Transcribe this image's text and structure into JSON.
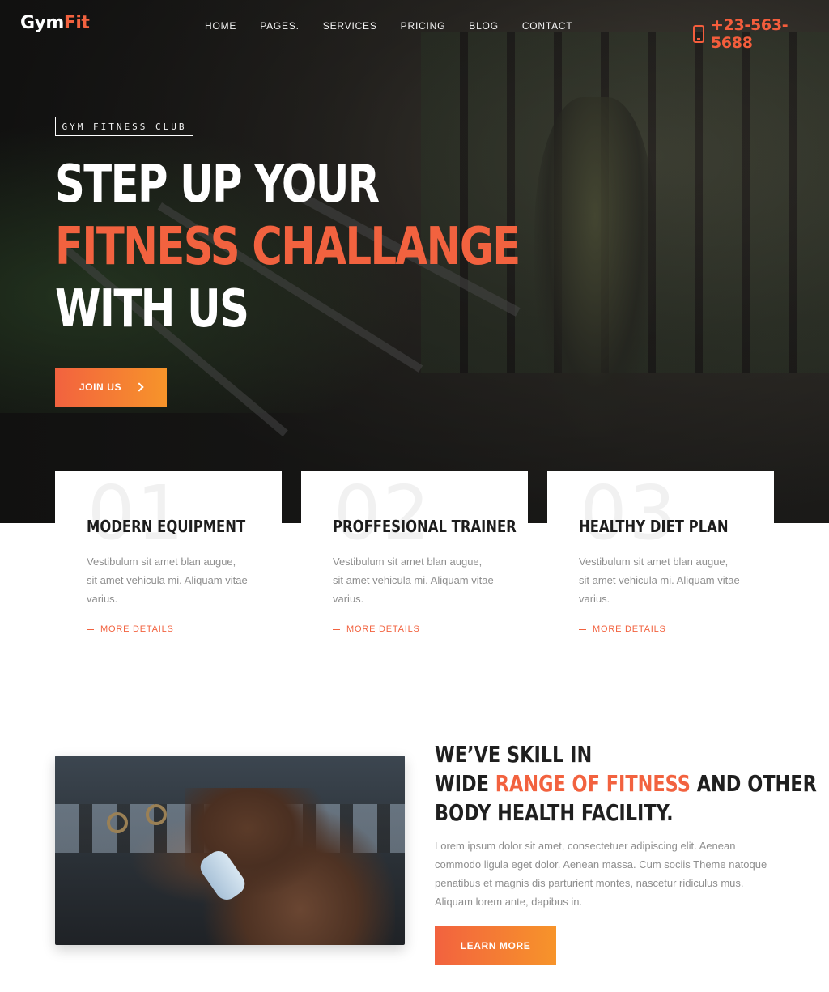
{
  "brand": {
    "logo_main": "Gym",
    "logo_accent": "Fit"
  },
  "nav": {
    "items": [
      "HOME",
      "PAGES.",
      "SERVICES",
      "PRICING",
      "BLOG",
      "CONTACT"
    ]
  },
  "contact": {
    "phone": "+23-563-5688",
    "icon": "phone-icon"
  },
  "hero": {
    "tag": "GYM FITNESS CLUB",
    "line1": "STEP UP YOUR",
    "line2": "FITNESS CHALLANGE",
    "line3": "WITH US",
    "cta_label": "JOIN US",
    "cta_icon": "chevron-right-icon"
  },
  "features": [
    {
      "number": "01",
      "title": "MODERN EQUIPMENT",
      "desc": "Vestibulum sit amet blan augue, sit amet vehicula mi. Aliquam vitae varius.",
      "link": "MORE DETAILS"
    },
    {
      "number": "02",
      "title": "PROFFESIONAL TRAINER",
      "desc": "Vestibulum sit amet blan augue, sit amet vehicula mi. Aliquam vitae varius.",
      "link": "MORE DETAILS"
    },
    {
      "number": "03",
      "title": "HEALTHY DIET PLAN",
      "desc": "Vestibulum sit amet blan augue, sit amet vehicula mi. Aliquam vitae varius.",
      "link": "MORE DETAILS"
    }
  ],
  "about": {
    "heading_line1": "WE’VE SKILL IN",
    "heading_line2_pre": "WIDE ",
    "heading_line2_accent": "RANGE OF FITNESS",
    "heading_line2_post": " AND OTHER",
    "heading_line3": "BODY HEALTH FACILITY.",
    "body": "Lorem ipsum dolor sit amet, consectetuer adipiscing elit. Aenean commodo ligula eget dolor. Aenean massa. Cum sociis Theme natoque penatibus et magnis dis parturient montes, nascetur ridiculus mus. Aliquam lorem ante, dapibus in.",
    "cta_label": "LEARN MORE"
  },
  "colors": {
    "accent": "#f2623f",
    "accent_gradient_end": "#f7942a",
    "text_dark": "#1f1f1f",
    "text_muted": "#8e8e8e"
  }
}
